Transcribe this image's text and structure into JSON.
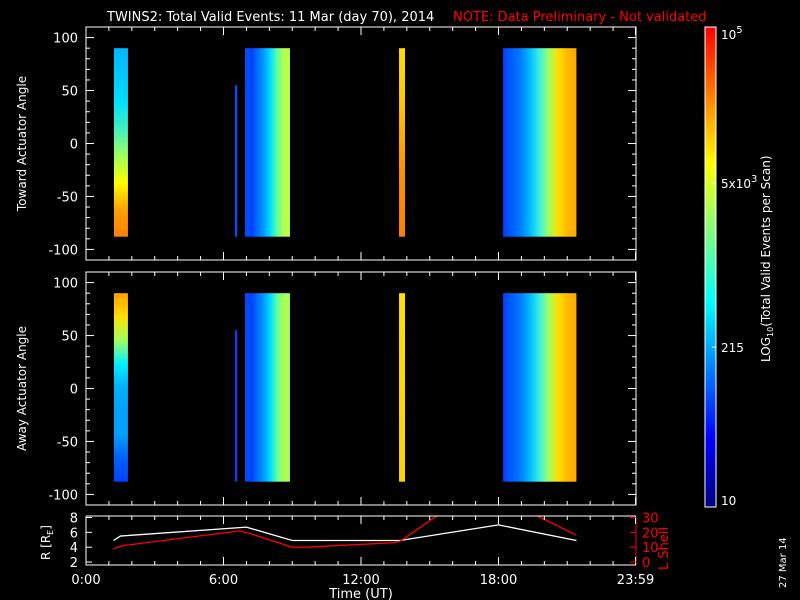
{
  "header": {
    "title": "TWINS2: Total Valid Events: 11 Mar (day  70), 2014",
    "note": "NOTE: Data Preliminary - Not validated"
  },
  "footer": {
    "date_stamp": "27 Mar 14"
  },
  "colors": {
    "note": "#ff0000",
    "lshell": "#ff0000",
    "r": "#ffffff"
  },
  "chart_data": [
    {
      "type": "heatmap",
      "name": "toward",
      "ylabel": "Toward Actuator Angle",
      "xlim": [
        0,
        24
      ],
      "ylim": [
        -110,
        110
      ],
      "yticks": [
        100,
        50,
        0,
        -50,
        -100
      ],
      "yticklabels": [
        "100",
        "50",
        "0",
        "-50",
        "-100"
      ],
      "bands": [
        {
          "t": [
            1.22,
            1.83
          ],
          "angle": [
            -88,
            90
          ],
          "dir": "v",
          "stops": [
            "#00b8ff",
            "#00c8ff",
            "#00e0ff",
            "#40f0c0",
            "#a0ff60",
            "#ffff00",
            "#ffa000",
            "#ff8000"
          ]
        },
        {
          "t": [
            6.5,
            6.6
          ],
          "angle": [
            -88,
            55
          ],
          "dir": "h",
          "stops": [
            "#0050ff",
            "#0050ff"
          ]
        },
        {
          "t": [
            6.94,
            8.9
          ],
          "angle": [
            -88,
            90
          ],
          "dir": "h",
          "stops": [
            "#0050ff",
            "#0040ff",
            "#0070ff",
            "#00a0ff",
            "#00e0ff",
            "#60ffa0",
            "#b0ff50",
            "#c0ff40"
          ]
        },
        {
          "t": [
            13.66,
            13.92
          ],
          "angle": [
            -88,
            90
          ],
          "dir": "v",
          "stops": [
            "#ffe000",
            "#ffc000",
            "#ff9000",
            "#ff8000"
          ]
        },
        {
          "t": [
            18.2,
            21.4
          ],
          "angle": [
            -88,
            90
          ],
          "dir": "h",
          "stops": [
            "#0040ff",
            "#0060ff",
            "#0080ff",
            "#00c0ff",
            "#40f0e0",
            "#a0ff60",
            "#ffe000",
            "#ffb800",
            "#ffa800"
          ]
        }
      ]
    },
    {
      "type": "heatmap",
      "name": "away",
      "ylabel": "Away Actuator Angle",
      "xlim": [
        0,
        24
      ],
      "ylim": [
        -110,
        110
      ],
      "yticks": [
        100,
        50,
        0,
        -50,
        -100
      ],
      "yticklabels": [
        "100",
        "50",
        "0",
        "-50",
        "-100"
      ],
      "bands": [
        {
          "t": [
            1.22,
            1.83
          ],
          "angle": [
            -88,
            90
          ],
          "dir": "v",
          "stops": [
            "#ffa000",
            "#ffe000",
            "#a0ff60",
            "#00f0ff",
            "#00b0ff",
            "#00a0ff",
            "#00a0ff",
            "#0060ff",
            "#0040ff"
          ]
        },
        {
          "t": [
            6.5,
            6.6
          ],
          "angle": [
            -88,
            55
          ],
          "dir": "h",
          "stops": [
            "#0040ff",
            "#0040ff"
          ]
        },
        {
          "t": [
            6.94,
            8.9
          ],
          "angle": [
            -88,
            90
          ],
          "dir": "h",
          "stops": [
            "#0050ff",
            "#0040ff",
            "#0070ff",
            "#00a0ff",
            "#00e0ff",
            "#60ffa0",
            "#b0ff50",
            "#a0ff60"
          ]
        },
        {
          "t": [
            13.66,
            13.92
          ],
          "angle": [
            -88,
            90
          ],
          "dir": "v",
          "stops": [
            "#ffe000",
            "#ffd800",
            "#ffd000"
          ]
        },
        {
          "t": [
            18.2,
            21.4
          ],
          "angle": [
            -88,
            90
          ],
          "dir": "h",
          "stops": [
            "#0040ff",
            "#0060ff",
            "#0080ff",
            "#00c0ff",
            "#40f0e0",
            "#a0ff60",
            "#ffe000",
            "#ffb800",
            "#ffa800"
          ]
        }
      ]
    },
    {
      "type": "line",
      "name": "orbit",
      "xlabel": "Time (UT)",
      "xticks": [
        0,
        6,
        12,
        18,
        23.98
      ],
      "xticklabels": [
        "0:00",
        "6:00",
        "12:00",
        "18:00",
        "23:59"
      ],
      "ylabel": "R [R",
      "ylabel_sub": "E",
      "ylabel_close": "]",
      "ylim": [
        1.6,
        8.2
      ],
      "yticks": [
        2,
        4,
        6,
        8
      ],
      "yticklabels": [
        "2",
        "4",
        "6",
        "8"
      ],
      "y2label": "L Shell",
      "y2lim": [
        -2,
        31
      ],
      "y2ticks": [
        0,
        10,
        20,
        30
      ],
      "y2ticklabels": [
        "0",
        "10",
        "20",
        "30"
      ],
      "series": [
        {
          "name": "R",
          "axis": "left",
          "segments": [
            [
              [
                1.2,
                4.9
              ],
              [
                1.5,
                5.5
              ],
              [
                7.0,
                6.7
              ],
              [
                9.0,
                4.9
              ],
              [
                13.7,
                4.9
              ],
              [
                18.0,
                7.0
              ],
              [
                21.4,
                4.9
              ]
            ]
          ]
        },
        {
          "name": "L Shell",
          "axis": "right",
          "segments": [
            [
              [
                1.2,
                9
              ],
              [
                1.6,
                11
              ],
              [
                6.7,
                21
              ],
              [
                7.2,
                19
              ],
              [
                9.0,
                10
              ],
              [
                9.6,
                10
              ],
              [
                13.4,
                13
              ],
              [
                13.7,
                14
              ],
              [
                15.3,
                31
              ]
            ],
            [
              [
                19.7,
                31
              ],
              [
                21.4,
                18
              ]
            ]
          ]
        }
      ]
    }
  ],
  "colorbar": {
    "label": "LOG",
    "label_sub": "10",
    "label_rest": "(Total Valid  Events per Scan)",
    "scale": "log",
    "range": [
      10,
      100000
    ],
    "ticks": [
      {
        "value": 100000,
        "label": "10",
        "sup": "5"
      },
      {
        "value": 5000,
        "label": "5x10",
        "sup": "3"
      },
      {
        "value": 215,
        "label": "215",
        "sup": ""
      },
      {
        "value": 10,
        "label": "10",
        "sup": ""
      }
    ]
  }
}
